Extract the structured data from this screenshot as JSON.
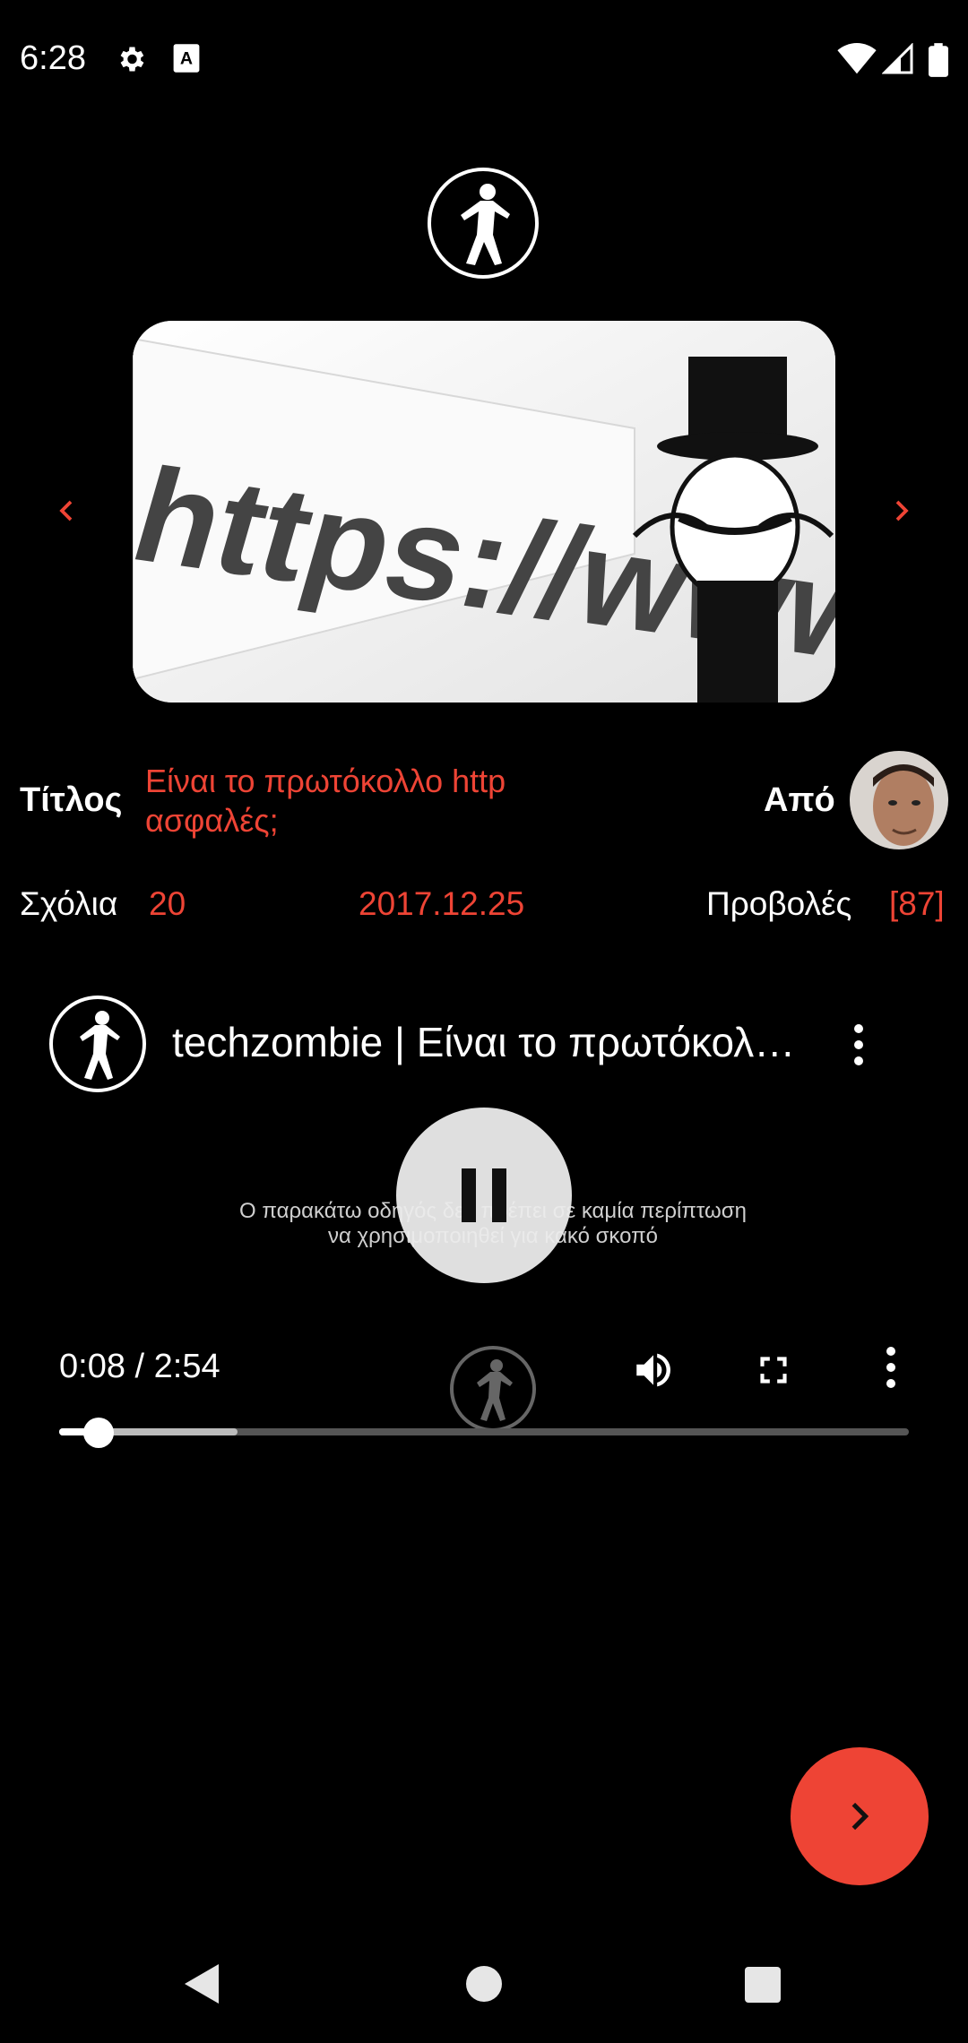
{
  "status_bar": {
    "time": "6:28",
    "icons": [
      "gear-icon",
      "keyboard-a-icon",
      "wifi-icon",
      "signal-icon",
      "battery-icon"
    ]
  },
  "header": {
    "logo_icon": "zombie-logo-icon"
  },
  "carousel": {
    "image_text": "https://www.",
    "prev_icon": "chevron-left-icon",
    "next_icon": "chevron-right-icon"
  },
  "info": {
    "title_label": "Τίτλος",
    "title_value": "Είναι το πρωτόκολλο http ασφαλές;",
    "author_label": "Από",
    "comments_label": "Σχόλια",
    "comments_count": "20",
    "date": "2017.12.25",
    "views_label": "Προβολές",
    "views_count": "[87]"
  },
  "player": {
    "video_title": "techzombie | Είναι το πρωτόκολλο http ασφαλές;",
    "caption_line1": "Ο παρακάτω οδηγός δεν πρέπει σε καμία περίπτωση",
    "caption_line2": "να χρησιμοποιηθεί για κακό σκοπό",
    "time_display": "0:08 / 2:54",
    "progress_fraction": 0.046,
    "buffered_fraction": 0.21
  },
  "fab": {
    "icon": "chevron-right-icon"
  },
  "nav": {
    "icons": [
      "back-icon",
      "home-icon",
      "recents-icon"
    ]
  },
  "colors": {
    "accent": "#ee4435",
    "background": "#000000"
  }
}
